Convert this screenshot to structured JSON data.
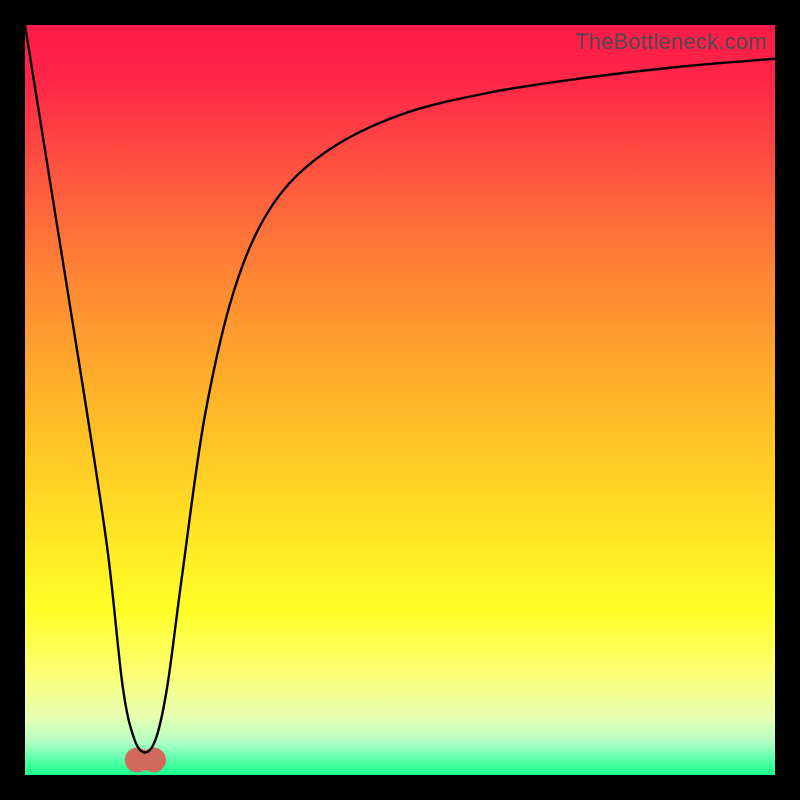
{
  "watermark": "TheBottleneck.com",
  "chart_data": {
    "type": "line",
    "title": "",
    "xlabel": "",
    "ylabel": "",
    "xlim": [
      0,
      100
    ],
    "ylim": [
      0,
      100
    ],
    "grid": false,
    "background_gradient_stops": [
      {
        "offset": 0.0,
        "color": "#ff1a49"
      },
      {
        "offset": 0.08,
        "color": "#ff2848"
      },
      {
        "offset": 0.2,
        "color": "#ff5640"
      },
      {
        "offset": 0.35,
        "color": "#ff8a34"
      },
      {
        "offset": 0.5,
        "color": "#ffb528"
      },
      {
        "offset": 0.65,
        "color": "#ffdd24"
      },
      {
        "offset": 0.78,
        "color": "#ffff28"
      },
      {
        "offset": 0.86,
        "color": "#fdff71"
      },
      {
        "offset": 0.92,
        "color": "#e9ffb0"
      },
      {
        "offset": 0.955,
        "color": "#b5ffc4"
      },
      {
        "offset": 0.975,
        "color": "#6affb0"
      },
      {
        "offset": 1.0,
        "color": "#15ff8a"
      }
    ],
    "series": [
      {
        "name": "bottleneck-curve",
        "stroke": "#000000",
        "stroke_width": 2.4,
        "x": [
          0,
          4,
          8,
          11,
          13,
          14.5,
          16,
          17.5,
          19,
          21,
          24,
          28,
          33,
          40,
          50,
          62,
          75,
          88,
          100
        ],
        "values": [
          100,
          75,
          50,
          30,
          12,
          5,
          3,
          5,
          12,
          27,
          48,
          65,
          76,
          83,
          88,
          91,
          93,
          94.5,
          95.5
        ]
      }
    ],
    "marker": {
      "name": "min-marker",
      "shape": "rounded_bar",
      "color": "#d2695e",
      "x_start": 13.3,
      "x_end": 18.8,
      "y": 2.0,
      "height": 2.8,
      "end_radius": 1.65
    }
  }
}
